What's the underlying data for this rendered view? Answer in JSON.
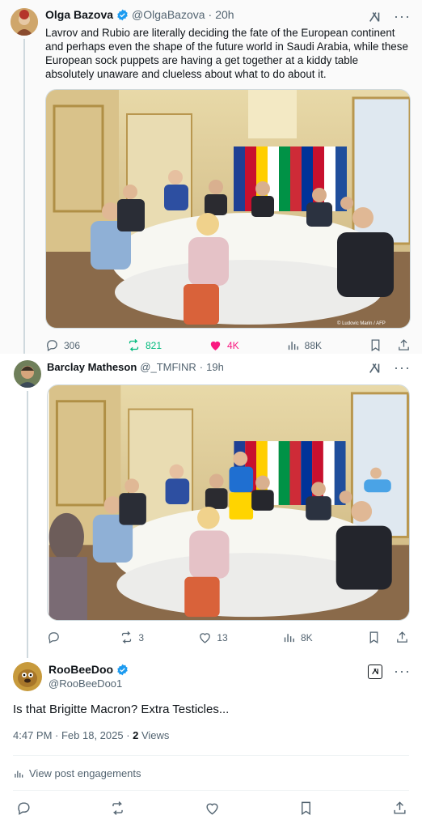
{
  "tweet1": {
    "name": "Olga Bazova",
    "handle": "@OlgaBazova",
    "time": "20h",
    "text": "Lavrov and Rubio are literally deciding the fate of the European continent and perhaps even the shape of the future world in Saudi Arabia, while these European sock puppets are having a get together at a kiddy table absolutely unaware and clueless about what to do about it.",
    "replies": "306",
    "reposts": "821",
    "likes": "4K",
    "views": "88K",
    "media_watermark": "© Ludovic Marin / AFP"
  },
  "tweet2": {
    "name": "Barclay Matheson",
    "handle": "@_TMFINR",
    "time": "19h",
    "replies": "",
    "reposts": "3",
    "likes": "13",
    "views": "8K"
  },
  "tweet3": {
    "name": "RooBeeDoo",
    "handle": "@RooBeeDoo1",
    "text": "Is that Brigitte Macron? Extra Testicles...",
    "time": "4:47 PM · Feb 18, 2025 · ",
    "views_count": "2",
    "views_label": " Views",
    "engagements": "View post engagements"
  },
  "colors": {
    "verified": "#1d9bf0",
    "repost_active": "#00ba7c",
    "like_active": "#f91880",
    "secondary": "#536471"
  }
}
